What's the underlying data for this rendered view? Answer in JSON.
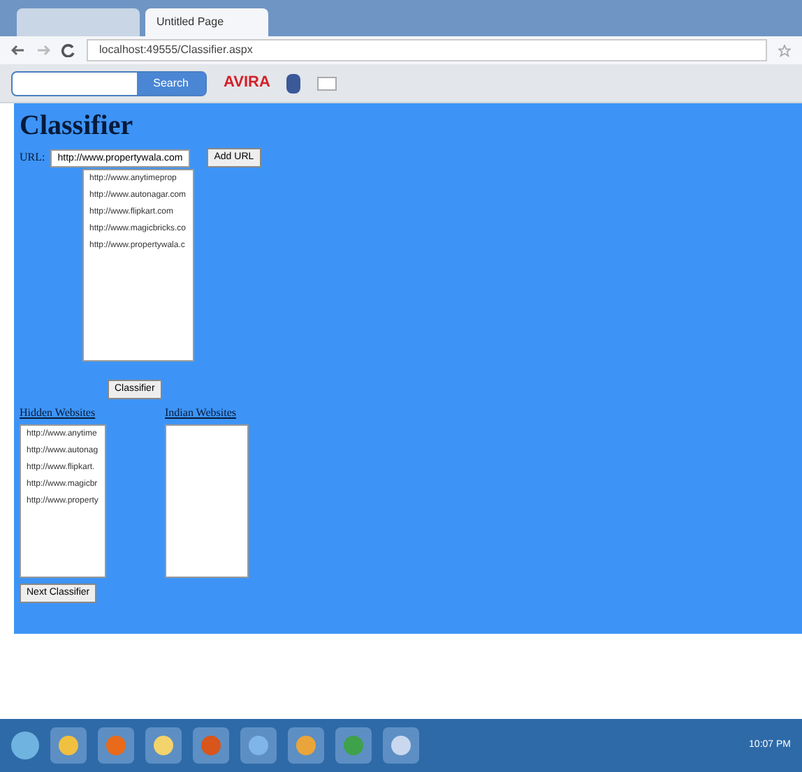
{
  "browser": {
    "tabs": [
      {
        "selected": false
      },
      {
        "label": "Untitled Page",
        "selected": true
      }
    ],
    "address": "localhost:49555/Classifier.aspx",
    "toolbar": {
      "search_button": "Search",
      "brand": "AVIRA"
    }
  },
  "page": {
    "title": "Classifier",
    "url_label": "URL:",
    "url_value": "http://www.propertywala.com",
    "add_button": "Add URL",
    "url_list": [
      "http://www.anytimeprop",
      "http://www.autonagar.com",
      "http://www.flipkart.com",
      "http://www.magicbricks.co",
      "http://www.propertywala.c"
    ],
    "classify_button": "Classifier",
    "hidden_label": "Hidden Websites",
    "hidden_list": [
      "http://www.anytime",
      "http://www.autonag",
      "http://www.flipkart.",
      "http://www.magicbr",
      "http://www.property"
    ],
    "indian_label": "Indian Websites",
    "next_button": "Next Classifier"
  },
  "taskbar": {
    "clock": "10:07 PM"
  }
}
